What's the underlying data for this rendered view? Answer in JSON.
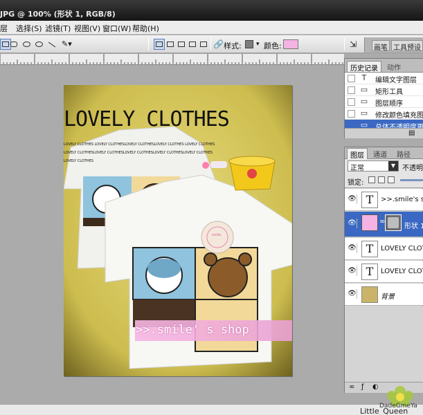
{
  "window": {
    "title": "JPG @ 100% (形状 1, RGB/8)"
  },
  "menu": [
    {
      "label": "层"
    },
    {
      "label": "选择(S)"
    },
    {
      "label": "滤镜(T)"
    },
    {
      "label": "视图(V)"
    },
    {
      "label": "窗口(W)"
    },
    {
      "label": "帮助(H)"
    }
  ],
  "options": {
    "style_label": "样式:",
    "color_label": "颜色:",
    "swatch_color": "#f4b3e3"
  },
  "panel_tabs": [
    "画笔",
    "工具预设"
  ],
  "history": {
    "tabs": [
      "历史记录",
      "动作"
    ],
    "items": [
      {
        "label": "编辑文字图层",
        "icon": "T"
      },
      {
        "label": "矩形工具",
        "icon": "▭"
      },
      {
        "label": "图层顺序",
        "icon": "▭"
      },
      {
        "label": "修改颜色填充图层",
        "icon": "▭"
      },
      {
        "label": "总体不透明度更改",
        "icon": "▭",
        "active": true
      }
    ]
  },
  "layers": {
    "tabs": [
      "图层",
      "通道",
      "路径"
    ],
    "blend_mode": "正常",
    "opacity_label": "不透明度:",
    "lock_label": "锁定:",
    "items": [
      {
        "name": ">>.smile's shop",
        "type": "text"
      },
      {
        "name": "形状 1",
        "type": "shape",
        "selected": true
      },
      {
        "name": "LOVELY CLOTHES",
        "type": "text"
      },
      {
        "name": "LOVELY CLOTHES",
        "type": "text"
      },
      {
        "name": "背景",
        "type": "image"
      }
    ]
  },
  "document": {
    "headline": "LOVELY CLOTHES",
    "tagline": ">>.smile' s shop",
    "small_lines": [
      "LOVELY CLOTHES LOVELY CLOTHESLOVELY CLOTHESLOVELY CLOTHES LOVELY CLOTHES",
      "LOVELY CLOTHESLOVELY CLOTHESLOVELY CLOTHESLOVELY CLOTHESLOVELY CLOTHES",
      "LOVELY CLOTHES"
    ],
    "tag_text": "smile"
  },
  "watermark": "Little_Queen",
  "stamp_text": "DadeGmeYa"
}
